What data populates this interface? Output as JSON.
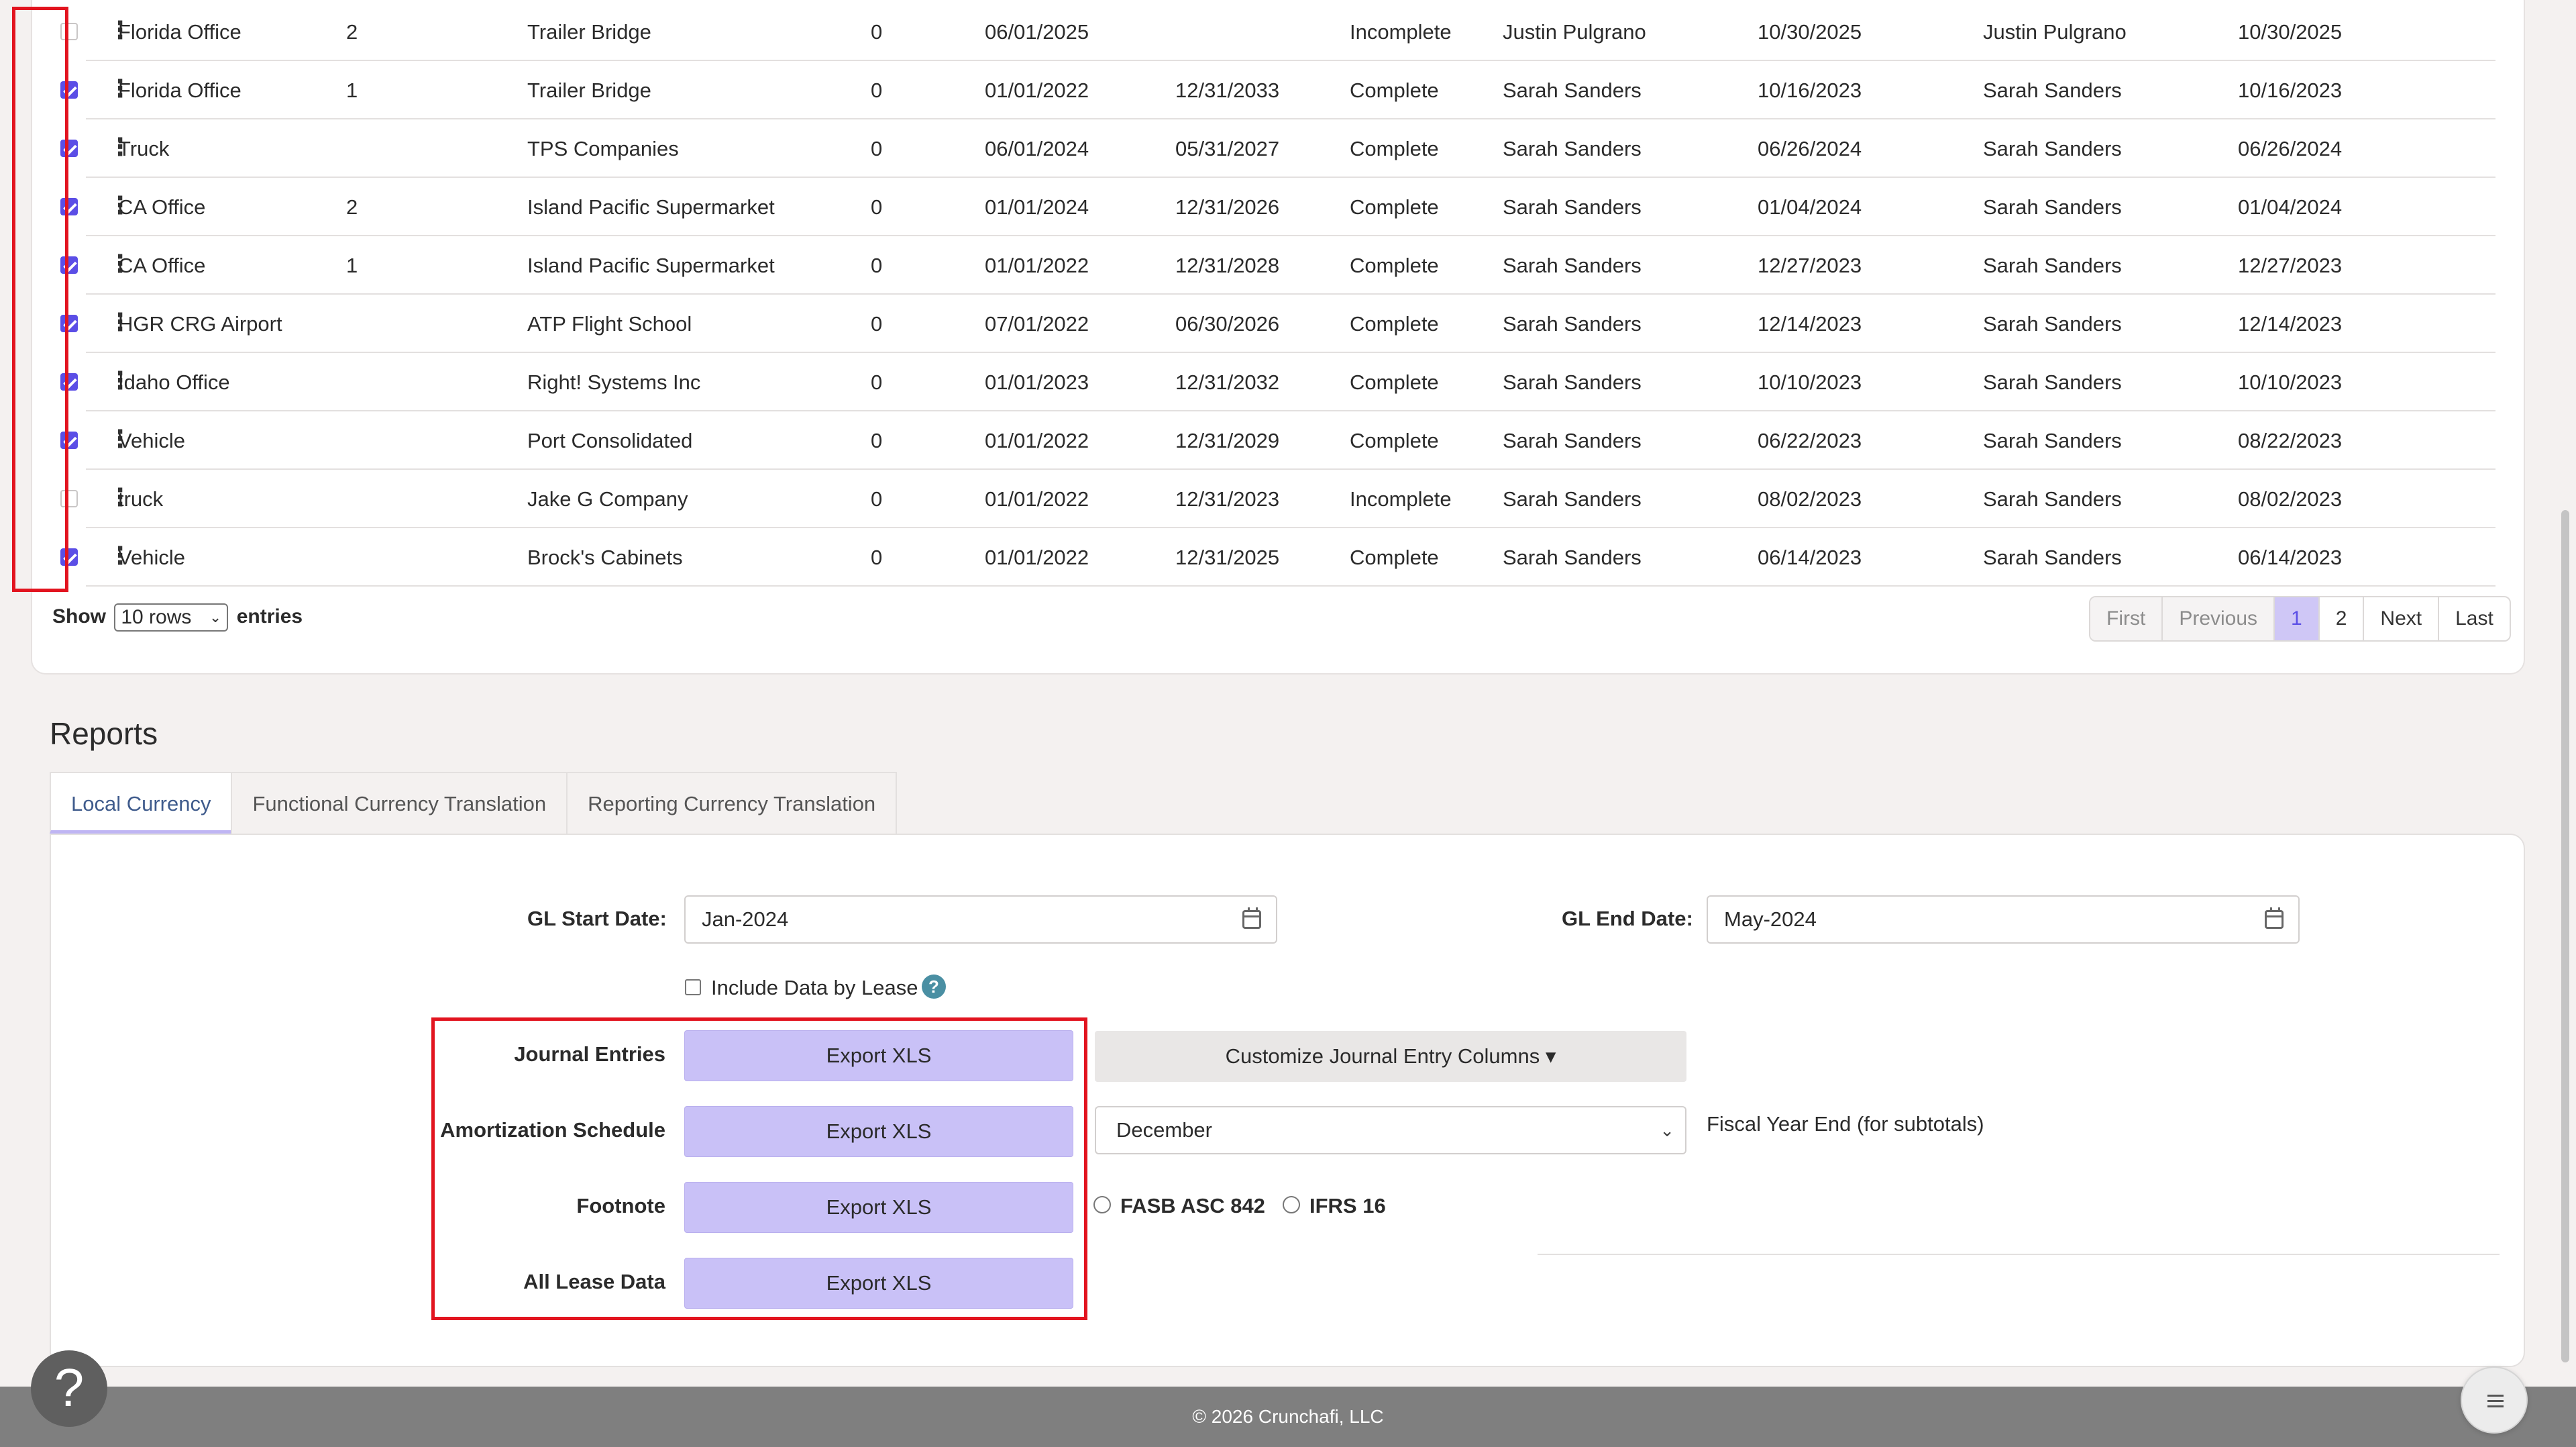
{
  "table": {
    "rows": [
      {
        "checked": false,
        "name": "Florida Office",
        "num": "2",
        "lessor": "Trailer Bridge",
        "zero": "0",
        "start": "06/01/2025",
        "end": "",
        "status": "Incomplete",
        "created_by": "Justin Pulgrano",
        "created": "10/30/2025",
        "modified_by": "Justin Pulgrano",
        "modified": "10/30/2025"
      },
      {
        "checked": true,
        "name": "Florida Office",
        "num": "1",
        "lessor": "Trailer Bridge",
        "zero": "0",
        "start": "01/01/2022",
        "end": "12/31/2033",
        "status": "Complete",
        "created_by": "Sarah Sanders",
        "created": "10/16/2023",
        "modified_by": "Sarah Sanders",
        "modified": "10/16/2023"
      },
      {
        "checked": true,
        "name": "Truck",
        "num": "",
        "lessor": "TPS Companies",
        "zero": "0",
        "start": "06/01/2024",
        "end": "05/31/2027",
        "status": "Complete",
        "created_by": "Sarah Sanders",
        "created": "06/26/2024",
        "modified_by": "Sarah Sanders",
        "modified": "06/26/2024"
      },
      {
        "checked": true,
        "name": "CA Office",
        "num": "2",
        "lessor": "Island Pacific Supermarket",
        "zero": "0",
        "start": "01/01/2024",
        "end": "12/31/2026",
        "status": "Complete",
        "created_by": "Sarah Sanders",
        "created": "01/04/2024",
        "modified_by": "Sarah Sanders",
        "modified": "01/04/2024"
      },
      {
        "checked": true,
        "name": "CA Office",
        "num": "1",
        "lessor": "Island Pacific Supermarket",
        "zero": "0",
        "start": "01/01/2022",
        "end": "12/31/2028",
        "status": "Complete",
        "created_by": "Sarah Sanders",
        "created": "12/27/2023",
        "modified_by": "Sarah Sanders",
        "modified": "12/27/2023"
      },
      {
        "checked": true,
        "name": "HGR CRG Airport",
        "num": "",
        "lessor": "ATP Flight School",
        "zero": "0",
        "start": "07/01/2022",
        "end": "06/30/2026",
        "status": "Complete",
        "created_by": "Sarah Sanders",
        "created": "12/14/2023",
        "modified_by": "Sarah Sanders",
        "modified": "12/14/2023"
      },
      {
        "checked": true,
        "name": "Idaho Office",
        "num": "",
        "lessor": "Right! Systems Inc",
        "zero": "0",
        "start": "01/01/2023",
        "end": "12/31/2032",
        "status": "Complete",
        "created_by": "Sarah Sanders",
        "created": "10/10/2023",
        "modified_by": "Sarah Sanders",
        "modified": "10/10/2023"
      },
      {
        "checked": true,
        "name": "Vehicle",
        "num": "",
        "lessor": "Port Consolidated",
        "zero": "0",
        "start": "01/01/2022",
        "end": "12/31/2029",
        "status": "Complete",
        "created_by": "Sarah Sanders",
        "created": "06/22/2023",
        "modified_by": "Sarah Sanders",
        "modified": "08/22/2023"
      },
      {
        "checked": false,
        "name": "truck",
        "num": "",
        "lessor": "Jake G Company",
        "zero": "0",
        "start": "01/01/2022",
        "end": "12/31/2023",
        "status": "Incomplete",
        "created_by": "Sarah Sanders",
        "created": "08/02/2023",
        "modified_by": "Sarah Sanders",
        "modified": "08/02/2023"
      },
      {
        "checked": true,
        "name": "Vehicle",
        "num": "",
        "lessor": "Brock's Cabinets",
        "zero": "0",
        "start": "01/01/2022",
        "end": "12/31/2025",
        "status": "Complete",
        "created_by": "Sarah Sanders",
        "created": "06/14/2023",
        "modified_by": "Sarah Sanders",
        "modified": "06/14/2023"
      }
    ],
    "show_label": "Show",
    "rows_select": "10 rows",
    "entries_label": "entries",
    "pagination": [
      "First",
      "Previous",
      "1",
      "2",
      "Next",
      "Last"
    ],
    "active_page": "1"
  },
  "reports": {
    "title": "Reports",
    "tabs": [
      "Local Currency",
      "Functional Currency Translation",
      "Reporting Currency Translation"
    ],
    "active_tab": "Local Currency",
    "gl_start_label": "GL Start Date:",
    "gl_start_value": "Jan-2024",
    "gl_end_label": "GL End Date:",
    "gl_end_value": "May-2024",
    "include_label": "Include Data by Lease",
    "help_glyph": "?",
    "export_rows": [
      {
        "label": "Journal Entries",
        "button": "Export XLS"
      },
      {
        "label": "Amortization Schedule",
        "button": "Export XLS"
      },
      {
        "label": "Footnote",
        "button": "Export XLS"
      },
      {
        "label": "All Lease Data",
        "button": "Export XLS"
      }
    ],
    "customize_label": "Customize Journal Entry Columns",
    "caret": "▾",
    "fiscal_month": "December",
    "fiscal_label": "Fiscal Year End (for subtotals)",
    "standards": [
      "FASB ASC 842",
      "IFRS 16"
    ]
  },
  "footer": {
    "text": "© 2026 Crunchafi, LLC"
  },
  "floating": {
    "help_glyph": "?"
  },
  "colors": {
    "accent": "#5b4ee6",
    "button_fill": "#c9c1f7",
    "highlight_border": "#e2141f",
    "footer_bg": "#7f7f7f"
  },
  "icons": [
    "kebab-menu-icon",
    "calendar-icon",
    "help-icon",
    "chevron-down-icon",
    "hamburger-menu-icon"
  ]
}
